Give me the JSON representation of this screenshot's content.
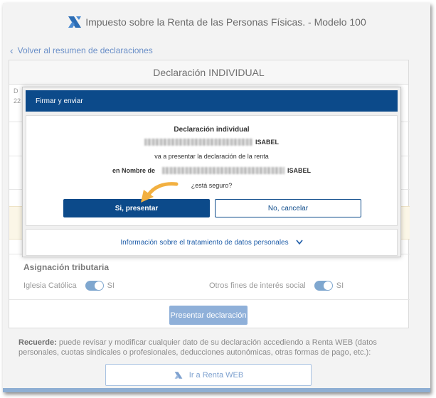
{
  "header": {
    "title": "Impuesto sobre la Renta de las Personas Físicas. - Modelo 100",
    "logo_icon": "aeat-logo-icon"
  },
  "back_link": {
    "label": "Volver al resumen de declaraciones"
  },
  "card": {
    "title": "Declaración INDIVIDUAL",
    "snippet_1": "D",
    "snippet_2": "22"
  },
  "asignacion": {
    "title": "Asignación tributaria",
    "iglesia_label": "Iglesia Católica",
    "iglesia_value": "SI",
    "otros_label": "Otros fines de interés social",
    "otros_value": "SI"
  },
  "present_button": "Presentar declaración",
  "recuerde": {
    "bold": "Recuerde:",
    "text": " puede revisar y modificar cualquier dato de su declaración accediendo a Renta WEB (datos personales, cuotas sindicales o profesionales, deducciones autonómicas, otras formas de pago, etc.):"
  },
  "renta_button": "Ir a Renta WEB",
  "modal": {
    "header": "Firmar y enviar",
    "line_title": "Declaración individual",
    "name_suffix_1": "ISABEL",
    "line_presentar": "va a presentar la declaración de la renta",
    "nombre_prefix": "en Nombre de",
    "name_suffix_2": "ISABEL",
    "question": "¿está seguro?",
    "yes_button": "Si, presentar",
    "no_button": "No, cancelar",
    "info_link": "Información sobre el tratamiento de datos personales"
  },
  "colors": {
    "primary": "#0c4a8a",
    "toggle": "#7fa7cf",
    "arrow": "#f2b041"
  }
}
